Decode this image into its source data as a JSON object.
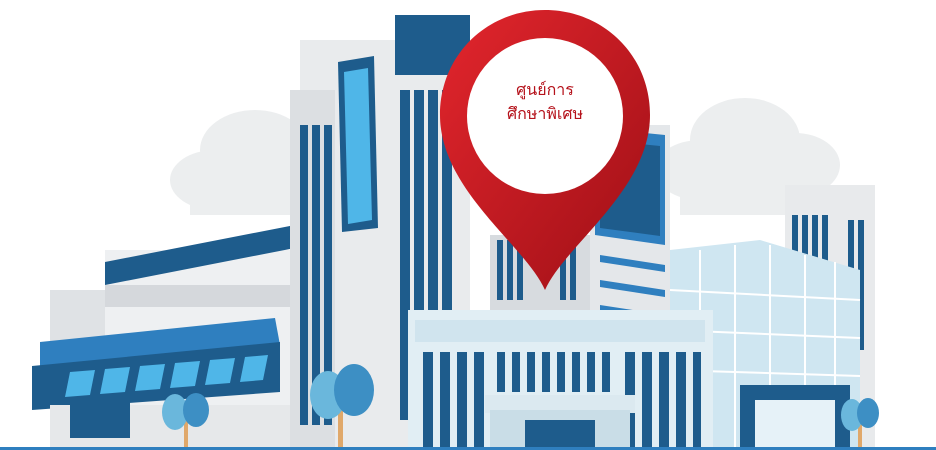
{
  "location_pin": {
    "line1": "ศูนย์การ",
    "line2": "ศึกษาพิเศษ"
  },
  "colors": {
    "pin_red": "#c8161e",
    "dark_blue": "#1e5c8c",
    "medium_blue": "#2f7fbf",
    "glass_blue": "#4fb6e8",
    "light_gray": "#e6e8ea",
    "tree_blue": "#6ab7dc",
    "trunk": "#e0a86a"
  }
}
